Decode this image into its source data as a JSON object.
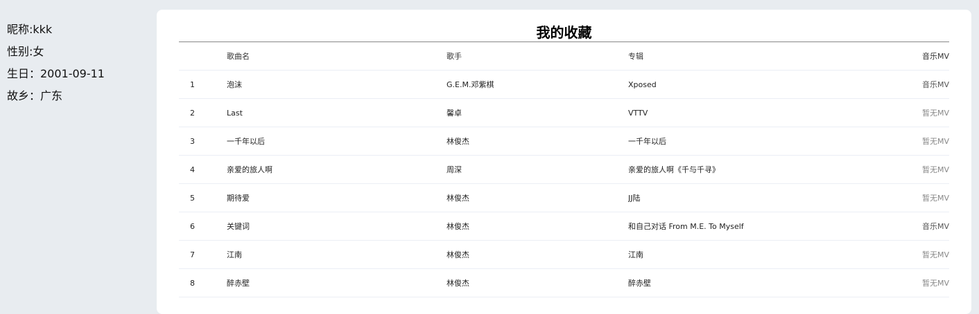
{
  "profile": {
    "nickname": "昵称:kkk",
    "gender": "性别:女",
    "birthday": "生日：2001-09-11",
    "hometown": "故乡：广东"
  },
  "favorites": {
    "title": "我的收藏",
    "columns": {
      "index": "",
      "song": "歌曲名",
      "artist": "歌手",
      "album": "专辑",
      "mv": "音乐MV"
    },
    "rows": [
      {
        "index": "1",
        "song": "泡沫",
        "artist": "G.E.M.邓紫棋",
        "album": "Xposed",
        "mv": "音乐MV"
      },
      {
        "index": "2",
        "song": "Last",
        "artist": "馨卓",
        "album": "VTTV",
        "mv": "暂无MV"
      },
      {
        "index": "3",
        "song": "一千年以后",
        "artist": "林俊杰",
        "album": "一千年以后",
        "mv": "暂无MV"
      },
      {
        "index": "4",
        "song": "亲爱的旅人啊",
        "artist": "周深",
        "album": "亲爱的旅人啊《千与千寻》",
        "mv": "暂无MV"
      },
      {
        "index": "5",
        "song": "期待爱",
        "artist": "林俊杰",
        "album": "JJ陆",
        "mv": "暂无MV"
      },
      {
        "index": "6",
        "song": "关键词",
        "artist": "林俊杰",
        "album": "和自己对话 From M.E. To Myself",
        "mv": "音乐MV"
      },
      {
        "index": "7",
        "song": "江南",
        "artist": "林俊杰",
        "album": "江南",
        "mv": "暂无MV"
      },
      {
        "index": "8",
        "song": "醉赤壁",
        "artist": "林俊杰",
        "album": "醉赤壁",
        "mv": "暂无MV"
      }
    ]
  }
}
